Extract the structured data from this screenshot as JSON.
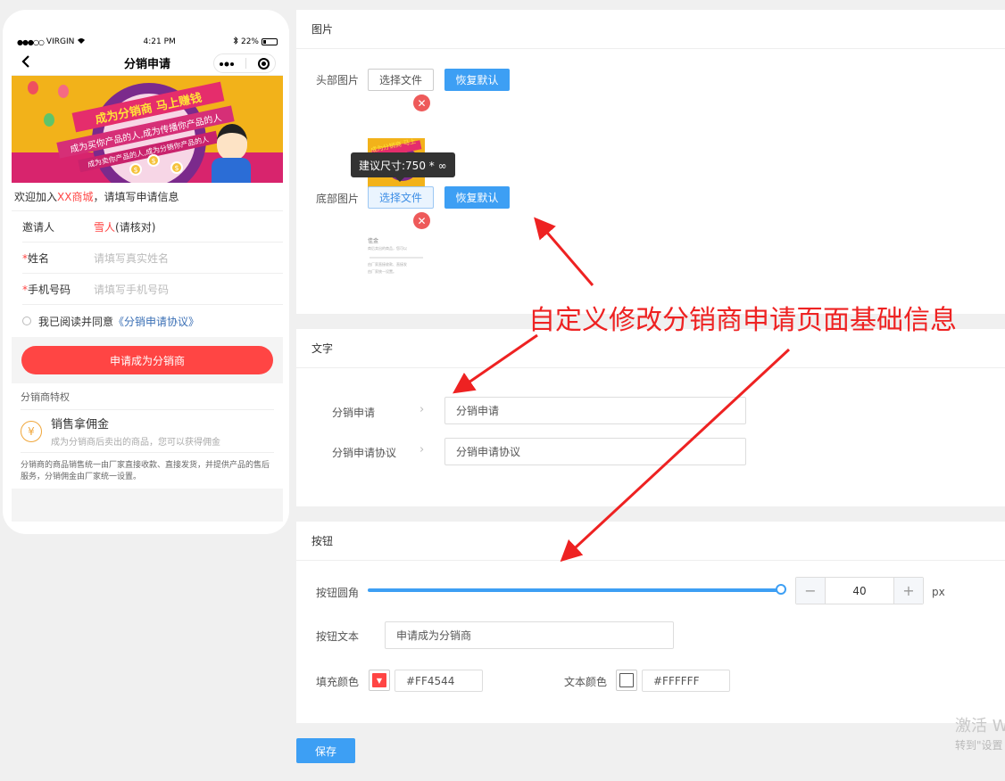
{
  "phone": {
    "status": {
      "carrier": "VIRGIN",
      "time": "4:21 PM",
      "battery": "22%"
    },
    "nav_title": "分销申请",
    "banner": {
      "headline": "成为分销商 马上赚钱",
      "line1": "成为买你产品的人,成为传播你产品的人",
      "line2": "成为卖你产品的人,成为分销你产品的人"
    },
    "welcome": {
      "prefix": "欢迎加入",
      "shop": "XX商城",
      "suffix": "，请填写申请信息"
    },
    "form": {
      "inviter_label": "邀请人",
      "inviter_name": "雪人",
      "inviter_note": "(请核对)",
      "name_label": "姓名",
      "name_placeholder": "请填写真实姓名",
      "phone_label": "手机号码",
      "phone_placeholder": "请填写手机号码"
    },
    "agree": {
      "text": "我已阅读并同意",
      "link": "《分销申请协议》"
    },
    "apply_button": "申请成为分销商",
    "privileges": {
      "title": "分销商特权",
      "item_title": "销售拿佣金",
      "item_desc": "成为分销商后卖出的商品，您可以获得佣金",
      "note": "分销商的商品销售统一由厂家直接收款、直接发货，并提供产品的售后服务，分销佣金由厂家统一设置。"
    }
  },
  "image_section": {
    "title": "图片",
    "header_label": "头部图片",
    "footer_label": "底部图片",
    "choose_file": "选择文件",
    "reset": "恢复默认",
    "tooltip": "建议尺寸:750 * ∞",
    "thumb_headline": "成为分销商 马上赚钱",
    "thumb_footer_title": "佳金",
    "thumb_footer_line1": "商后卖出的商品，您可以",
    "thumb_footer_line2": "由厂家直接收款、直接发",
    "thumb_footer_line3": "由厂家统一设置。"
  },
  "text_section": {
    "title": "文字",
    "rows": [
      {
        "label": "分销申请",
        "value": "分销申请"
      },
      {
        "label": "分销申请协议",
        "value": "分销申请协议"
      }
    ]
  },
  "button_section": {
    "title": "按钮",
    "radius_label": "按钮圆角",
    "radius_value": "40",
    "radius_fraction": 1.0,
    "unit": "px",
    "text_label": "按钮文本",
    "text_value": "申请成为分销商",
    "fill_label": "填充颜色",
    "fill_value": "#FF4544",
    "text_color_label": "文本颜色",
    "text_color_value": "#FFFFFF",
    "minus": "−",
    "plus": "+"
  },
  "save_button": "保存",
  "annotation": "自定义修改分销商申请页面基础信息",
  "watermark": {
    "line1": "激活 W",
    "line2": "转到\"设置"
  },
  "colors": {
    "accent": "#3d9ff4",
    "brand_red": "#ff4544",
    "annotation_red": "#ee2222"
  }
}
